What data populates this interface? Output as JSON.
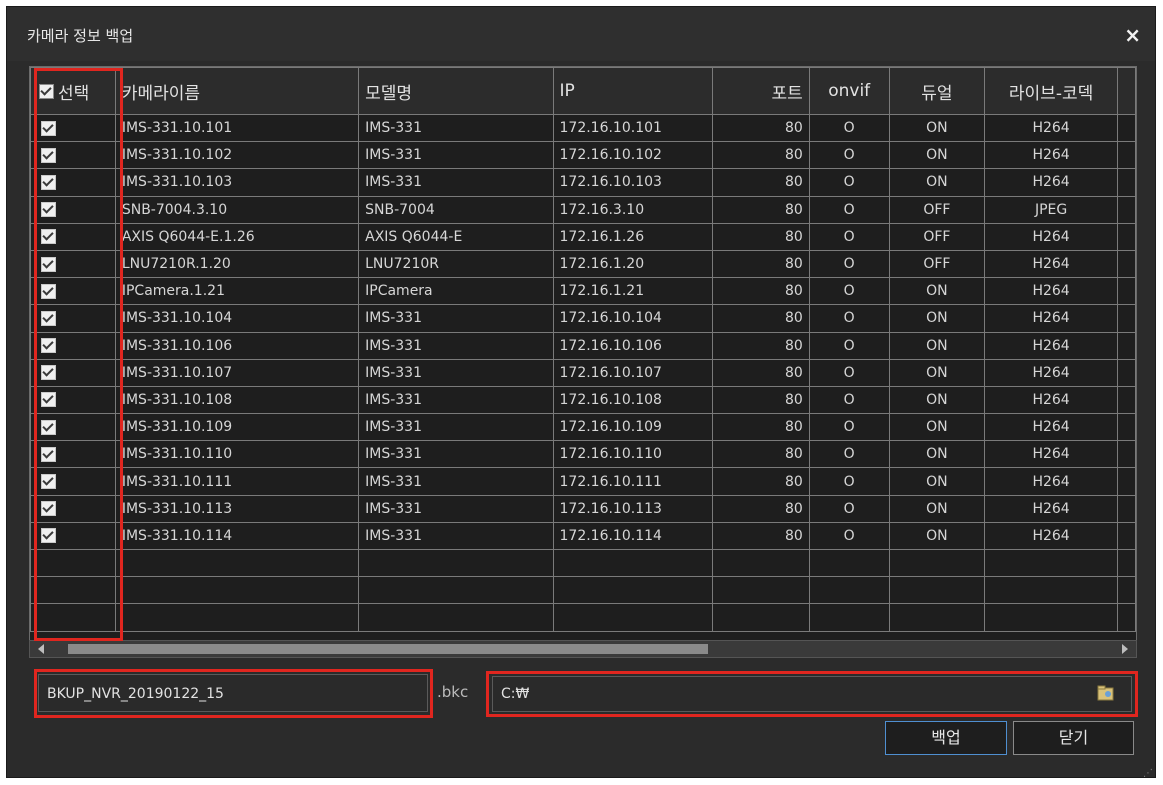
{
  "window": {
    "title": "카메라 정보 백업",
    "close_label": "×"
  },
  "table": {
    "columns": [
      "선택",
      "카메라이름",
      "모델명",
      "IP",
      "포트",
      "onvif",
      "듀얼",
      "라이브-코덱"
    ],
    "rows": [
      {
        "name": "IMS-331.10.101",
        "model": "IMS-331",
        "ip": "172.16.10.101",
        "port": "80",
        "onvif": "O",
        "dual": "ON",
        "codec": "H264"
      },
      {
        "name": "IMS-331.10.102",
        "model": "IMS-331",
        "ip": "172.16.10.102",
        "port": "80",
        "onvif": "O",
        "dual": "ON",
        "codec": "H264"
      },
      {
        "name": "IMS-331.10.103",
        "model": "IMS-331",
        "ip": "172.16.10.103",
        "port": "80",
        "onvif": "O",
        "dual": "ON",
        "codec": "H264"
      },
      {
        "name": "SNB-7004.3.10",
        "model": "SNB-7004",
        "ip": "172.16.3.10",
        "port": "80",
        "onvif": "O",
        "dual": "OFF",
        "codec": "JPEG"
      },
      {
        "name": "AXIS Q6044-E.1.26",
        "model": "AXIS Q6044-E",
        "ip": "172.16.1.26",
        "port": "80",
        "onvif": "O",
        "dual": "OFF",
        "codec": "H264"
      },
      {
        "name": "LNU7210R.1.20",
        "model": "LNU7210R",
        "ip": "172.16.1.20",
        "port": "80",
        "onvif": "O",
        "dual": "OFF",
        "codec": "H264"
      },
      {
        "name": "IPCamera.1.21",
        "model": "IPCamera",
        "ip": "172.16.1.21",
        "port": "80",
        "onvif": "O",
        "dual": "ON",
        "codec": "H264"
      },
      {
        "name": "IMS-331.10.104",
        "model": "IMS-331",
        "ip": "172.16.10.104",
        "port": "80",
        "onvif": "O",
        "dual": "ON",
        "codec": "H264"
      },
      {
        "name": "IMS-331.10.106",
        "model": "IMS-331",
        "ip": "172.16.10.106",
        "port": "80",
        "onvif": "O",
        "dual": "ON",
        "codec": "H264"
      },
      {
        "name": "IMS-331.10.107",
        "model": "IMS-331",
        "ip": "172.16.10.107",
        "port": "80",
        "onvif": "O",
        "dual": "ON",
        "codec": "H264"
      },
      {
        "name": "IMS-331.10.108",
        "model": "IMS-331",
        "ip": "172.16.10.108",
        "port": "80",
        "onvif": "O",
        "dual": "ON",
        "codec": "H264"
      },
      {
        "name": "IMS-331.10.109",
        "model": "IMS-331",
        "ip": "172.16.10.109",
        "port": "80",
        "onvif": "O",
        "dual": "ON",
        "codec": "H264"
      },
      {
        "name": "IMS-331.10.110",
        "model": "IMS-331",
        "ip": "172.16.10.110",
        "port": "80",
        "onvif": "O",
        "dual": "ON",
        "codec": "H264"
      },
      {
        "name": "IMS-331.10.111",
        "model": "IMS-331",
        "ip": "172.16.10.111",
        "port": "80",
        "onvif": "O",
        "dual": "ON",
        "codec": "H264"
      },
      {
        "name": "IMS-331.10.113",
        "model": "IMS-331",
        "ip": "172.16.10.113",
        "port": "80",
        "onvif": "O",
        "dual": "ON",
        "codec": "H264"
      },
      {
        "name": "IMS-331.10.114",
        "model": "IMS-331",
        "ip": "172.16.10.114",
        "port": "80",
        "onvif": "O",
        "dual": "ON",
        "codec": "H264"
      }
    ],
    "empty_rows": 3,
    "all_checked": true
  },
  "backup": {
    "filename": "BKUP_NVR_20190122_15",
    "extension": ".bkc",
    "path": "C:₩",
    "backup_label": "백업",
    "close_label": "닫기"
  },
  "colors": {
    "background": "#2b2b2b",
    "highlight": "#e0261f",
    "primary_button_border": "#4f8fd1"
  },
  "icons": [
    "close-icon",
    "checkbox-icon",
    "folder-browse-icon",
    "scroll-left-icon",
    "scroll-right-icon",
    "resize-grip-icon"
  ]
}
